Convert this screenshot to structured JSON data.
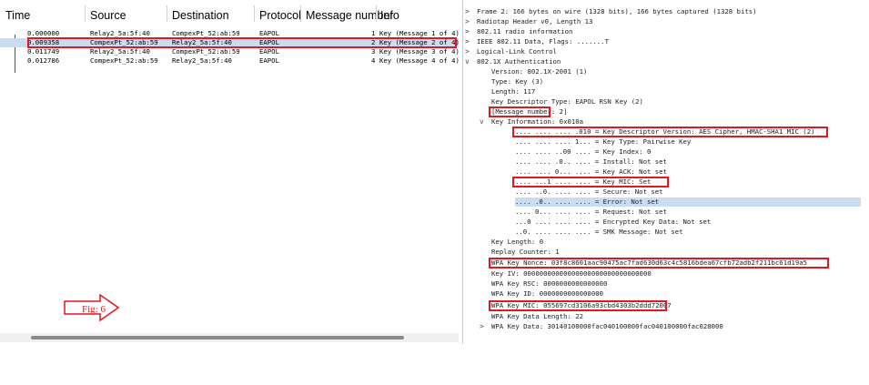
{
  "packet_list": {
    "columns": [
      "Time",
      "Source",
      "Destination",
      "Protocol",
      "Message number",
      "Info"
    ],
    "rows": [
      {
        "time": "0.000000",
        "source": "Relay2_5a:5f:40",
        "destination": "CompexPt_52:ab:59",
        "protocol": "EAPOL",
        "msg": "1",
        "info": "Key (Message 1 of 4)"
      },
      {
        "time": "0.009358",
        "source": "CompexPt_52:ab:59",
        "destination": "Relay2_5a:5f:40",
        "protocol": "EAPOL",
        "msg": "2",
        "info": "Key (Message 2 of 4)"
      },
      {
        "time": "0.011749",
        "source": "Relay2_5a:5f:40",
        "destination": "CompexPt_52:ab:59",
        "protocol": "EAPOL",
        "msg": "3",
        "info": "Key (Message 3 of 4)"
      },
      {
        "time": "0.012786",
        "source": "CompexPt_52:ab:59",
        "destination": "Relay2_5a:5f:40",
        "protocol": "EAPOL",
        "msg": "4",
        "info": "Key (Message 4 of 4)"
      }
    ],
    "selected_row": 1
  },
  "figure_label": "Fig: 6",
  "details": {
    "top": [
      {
        "expander": ">",
        "text": "Frame 2: 166 bytes on wire (1328 bits), 166 bytes captured (1328 bits)"
      },
      {
        "expander": ">",
        "text": "Radiotap Header v0, Length 13"
      },
      {
        "expander": ">",
        "text": "802.11 radio information"
      },
      {
        "expander": ">",
        "text": "IEEE 802.11 Data, Flags: .......T"
      },
      {
        "expander": ">",
        "text": "Logical-Link Control"
      },
      {
        "expander": "v",
        "text": "802.1X Authentication"
      }
    ],
    "auth": [
      "Version: 802.1X-2001 (1)",
      "Type: Key (3)",
      "Length: 117",
      "Key Descriptor Type: EAPOL RSN Key (2)",
      "[Message number: 2]"
    ],
    "key_info_header": {
      "expander": "v",
      "text": "Key Information: 0x010a"
    },
    "key_info_bits": [
      ".... .... .... .010 = Key Descriptor Version: AES Cipher, HMAC-SHA1 MIC (2)",
      ".... .... .... 1... = Key Type: Pairwise Key",
      ".... .... ..00 .... = Key Index: 0",
      ".... .... .0.. .... = Install: Not set",
      ".... .... 0... .... = Key ACK: Not set",
      ".... ...1 .... .... = Key MIC: Set",
      ".... ..0. .... .... = Secure: Not set",
      ".... .0.. .... .... = Error: Not set",
      ".... 0... .... .... = Request: Not set",
      "...0 .... .... .... = Encrypted Key Data: Not set",
      "..0. .... .... .... = SMK Message: Not set"
    ],
    "key_fields": [
      "Key Length: 0",
      "Replay Counter: 1",
      "WPA Key Nonce: 03f8c8601aac90475ac7fad630d63c4c5816bdea67cfb72adb2f211bc61d19a5",
      "Key IV: 00000000000000000000000000000000",
      "WPA Key RSC: 0000000000000000",
      "WPA Key ID: 0000000000000000",
      "WPA Key MIC: 055697cd3106a93cbd4303b2ddd72007",
      "WPA Key Data Length: 22"
    ],
    "key_data": {
      "expander": ">",
      "text": "WPA Key Data: 30140100000fac040100000fac040100000fac028000"
    }
  },
  "colors": {
    "highlight_red": "#e0191f",
    "selection_blue": "#c9dcf3"
  }
}
